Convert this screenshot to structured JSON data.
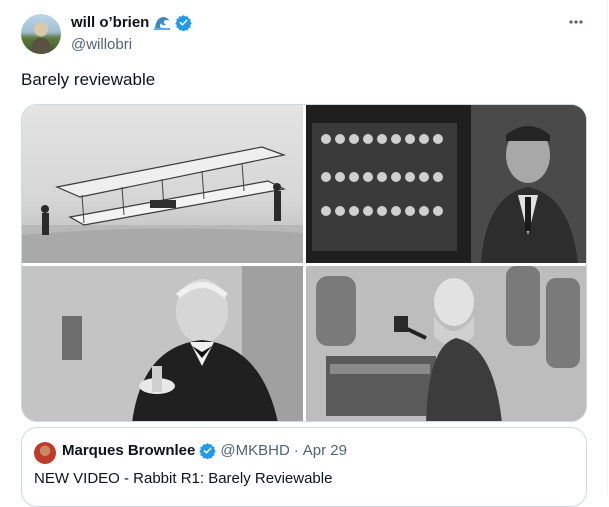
{
  "author": {
    "name": "will o’brien",
    "handle": "@willobri",
    "emoji_icon": "wave-icon",
    "verified_color": "#1d9bf0"
  },
  "tweet": {
    "text": "Barely reviewable"
  },
  "media": {
    "images": [
      "wright-glider-photo",
      "bombe-machine-photo",
      "edison-photo",
      "telephone-engraving-photo"
    ]
  },
  "quoted": {
    "name": "Marques Brownlee",
    "handle": "@MKBHD",
    "separator": "·",
    "date": "Apr 29",
    "text": "NEW VIDEO - Rabbit R1: Barely Reviewable"
  }
}
